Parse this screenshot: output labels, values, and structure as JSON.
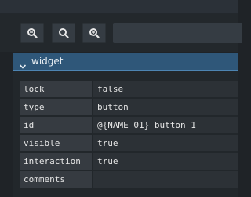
{
  "toolbar": {
    "buttons": [
      {
        "name": "zoom-out",
        "icon": "zoom-out-icon"
      },
      {
        "name": "zoom-reset",
        "icon": "zoom-reset-icon"
      },
      {
        "name": "zoom-in",
        "icon": "zoom-in-icon"
      }
    ],
    "search_value": ""
  },
  "section": {
    "title": "widget",
    "expanded": true,
    "icon": "chevron-down-icon"
  },
  "properties": [
    {
      "key": "lock",
      "value": "false"
    },
    {
      "key": "type",
      "value": "button"
    },
    {
      "key": "id",
      "value": "@{NAME_01}_button_1"
    },
    {
      "key": "visible",
      "value": "true"
    },
    {
      "key": "interaction",
      "value": "true"
    },
    {
      "key": "comments",
      "value": ""
    }
  ],
  "colors": {
    "background": "#1f2327",
    "section_header": "#2f5779",
    "section_accent": "#4d84b2",
    "key_cell": "#363b41",
    "value_cell": "#2c3136",
    "text": "#e6e6e6"
  }
}
